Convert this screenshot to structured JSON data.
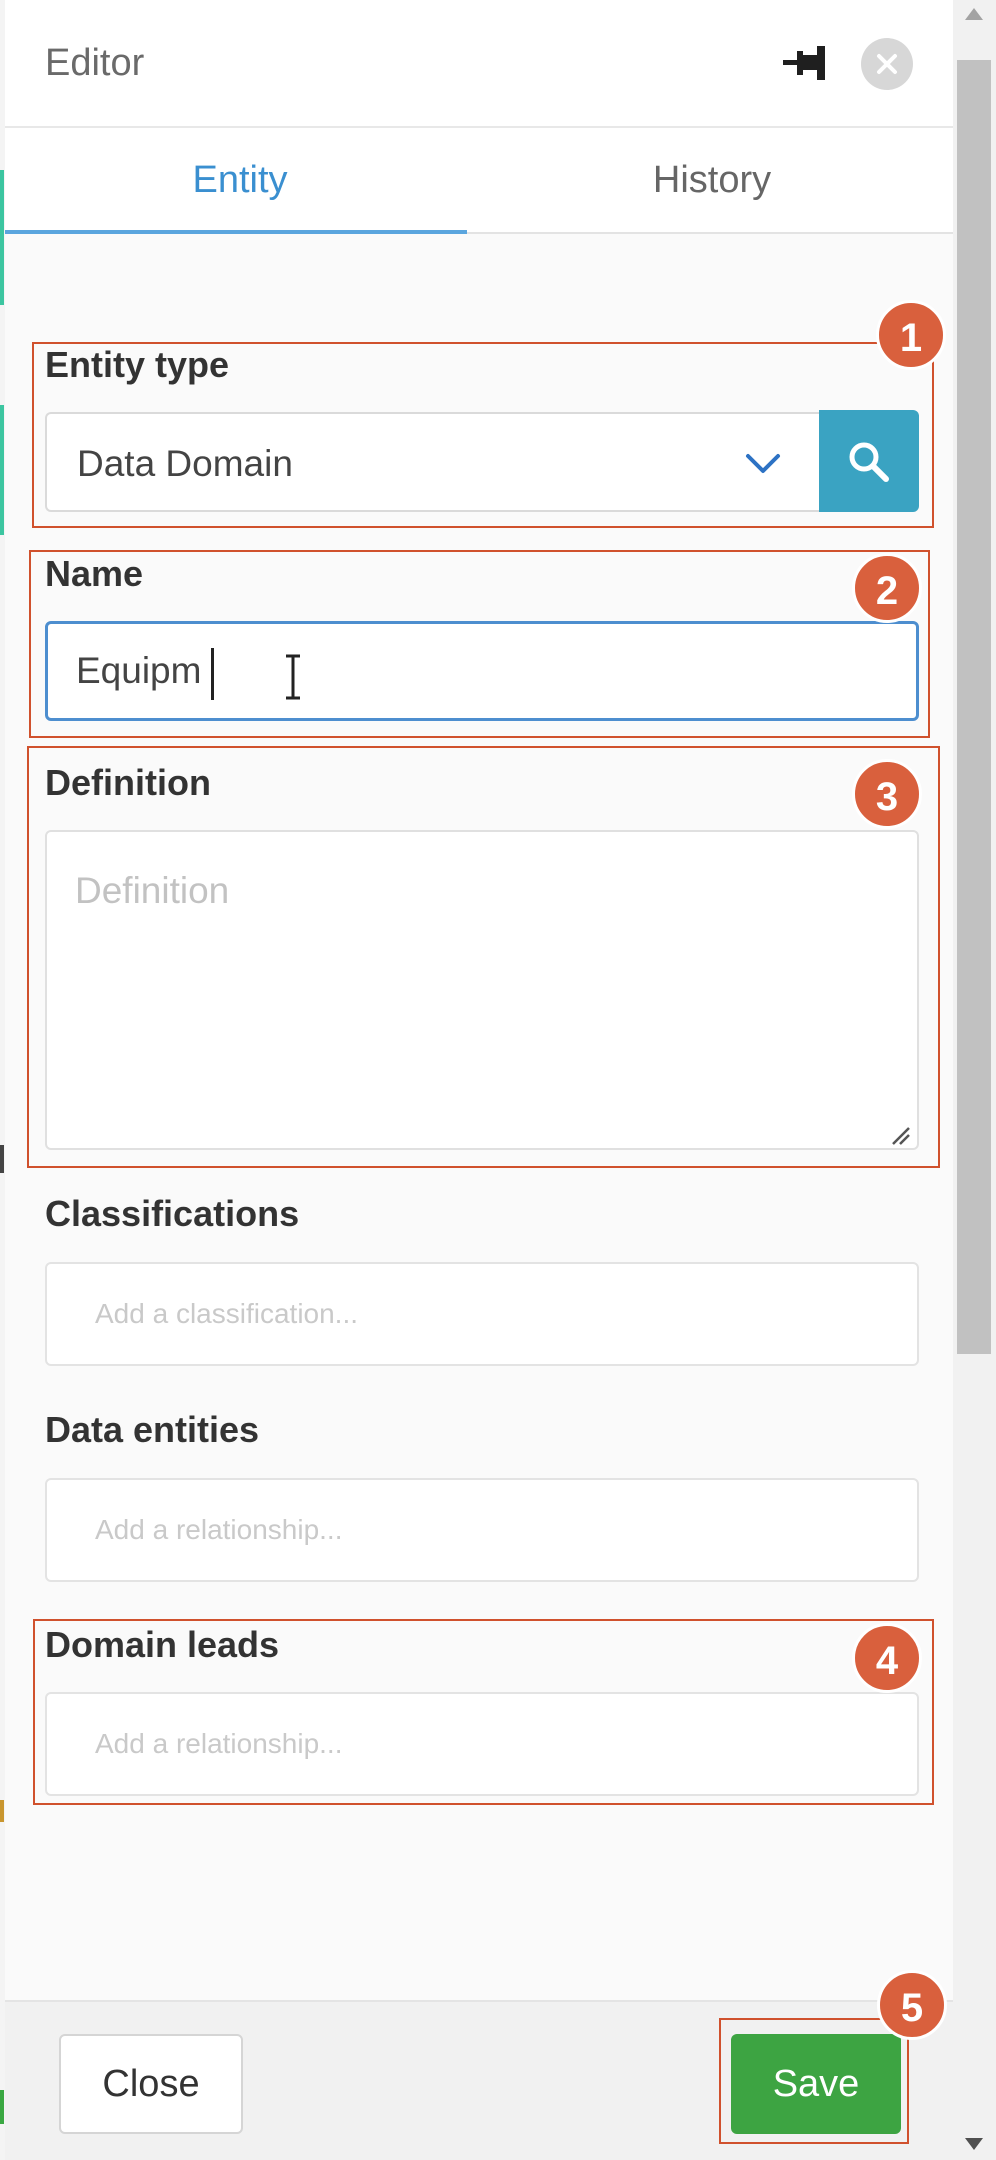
{
  "header": {
    "title": "Editor"
  },
  "tabs": [
    {
      "label": "Entity",
      "active": true
    },
    {
      "label": "History",
      "active": false
    }
  ],
  "fields": {
    "entity_type": {
      "label": "Entity type",
      "value": "Data Domain"
    },
    "name": {
      "label": "Name",
      "value": "Equipm"
    },
    "definition": {
      "label": "Definition",
      "placeholder": "Definition"
    },
    "classifications": {
      "label": "Classifications",
      "placeholder": "Add a classification..."
    },
    "data_entities": {
      "label": "Data entities",
      "placeholder": "Add a relationship..."
    },
    "domain_leads": {
      "label": "Domain leads",
      "placeholder": "Add a relationship..."
    }
  },
  "footer": {
    "close_label": "Close",
    "save_label": "Save"
  },
  "callouts": [
    "1",
    "2",
    "3",
    "4",
    "5"
  ],
  "colors": {
    "accent_blue": "#3a8fd0",
    "search_button": "#3aa3c2",
    "save_green": "#3da442",
    "callout_red": "#d9603d"
  }
}
